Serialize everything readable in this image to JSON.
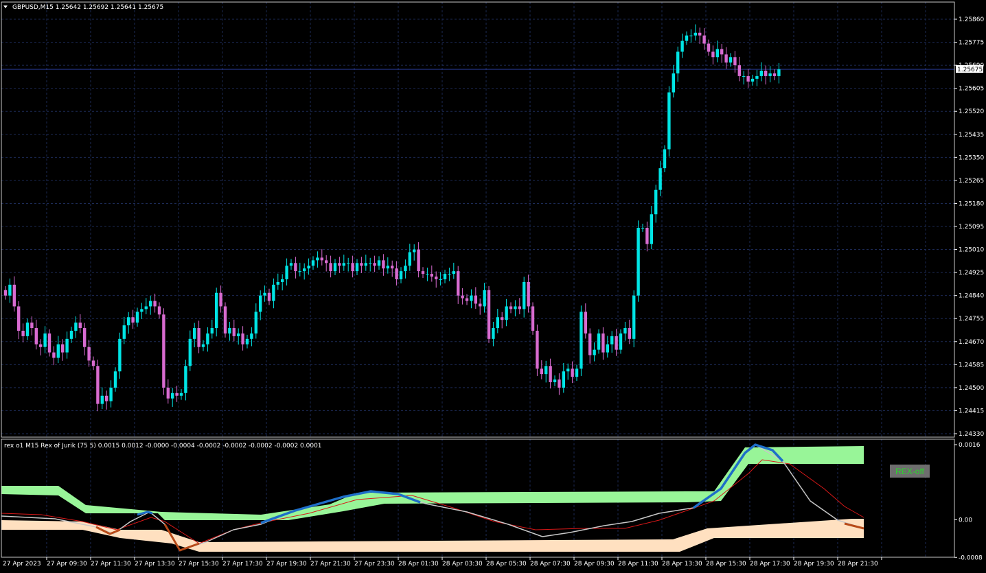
{
  "main": {
    "header_icon": "triangle-down-icon",
    "header": "GBPUSD,M15  1.25642 1.25692 1.25641 1.25675",
    "current_price": "1.25675",
    "price_axis": [
      "1.25860",
      "1.25775",
      "1.25690",
      "1.25605",
      "1.25520",
      "1.25435",
      "1.25350",
      "1.25265",
      "1.25180",
      "1.25095",
      "1.25010",
      "1.24925",
      "1.24840",
      "1.24755",
      "1.24670",
      "1.24585",
      "1.24500",
      "1.24415",
      "1.24330"
    ]
  },
  "indicator": {
    "header": "rex o1 M15 Rex of Jurik (75 5) 0.0015 0.0012 -0.0000 -0.0004 -0.0002 -0.0002 -0.0002 -0.0002 0.0001",
    "axis": [
      "0.0016",
      "0.00",
      "-0.0008"
    ],
    "button_label": "REX-off"
  },
  "time_axis": [
    "27 Apr 2023",
    "27 Apr 09:30",
    "27 Apr 11:30",
    "27 Apr 13:30",
    "27 Apr 15:30",
    "27 Apr 17:30",
    "27 Apr 19:30",
    "27 Apr 21:30",
    "27 Apr 23:30",
    "28 Apr 01:30",
    "28 Apr 03:30",
    "28 Apr 05:30",
    "28 Apr 07:30",
    "28 Apr 09:30",
    "28 Apr 11:30",
    "28 Apr 13:30",
    "28 Apr 15:30",
    "28 Apr 17:30",
    "28 Apr 19:30",
    "28 Apr 21:30"
  ],
  "colors": {
    "background": "#000000",
    "bull": "#00e5e5",
    "bear": "#d86bd0",
    "grid": "#1c2a55",
    "green_band": "#98f598",
    "peach_band": "#ffe0c0",
    "fast_line": "#c8c8c8",
    "slow_line": "#d81818",
    "highlight": "#1e6ec8",
    "highlight_down": "#b84a18"
  },
  "closes": [
    1.2484,
    1.2488,
    1.248,
    1.2471,
    1.2469,
    1.2474,
    1.2472,
    1.2466,
    1.2465,
    1.247,
    1.2463,
    1.2461,
    1.2466,
    1.2463,
    1.2468,
    1.2471,
    1.2474,
    1.2472,
    1.2465,
    1.246,
    1.2458,
    1.2444,
    1.2447,
    1.2445,
    1.245,
    1.2456,
    1.2468,
    1.2473,
    1.2476,
    1.2474,
    1.2478,
    1.2479,
    1.248,
    1.2482,
    1.248,
    1.2477,
    1.245,
    1.2446,
    1.2448,
    1.2447,
    1.2448,
    1.2458,
    1.2468,
    1.2472,
    1.2465,
    1.2466,
    1.247,
    1.2472,
    1.2485,
    1.248,
    1.247,
    1.2472,
    1.2469,
    1.247,
    1.2466,
    1.2468,
    1.247,
    1.2478,
    1.2484,
    1.2485,
    1.2482,
    1.2488,
    1.2489,
    1.249,
    1.2495,
    1.2496,
    1.2493,
    1.2493,
    1.2494,
    1.2495,
    1.2497,
    1.2498,
    1.2497,
    1.2496,
    1.2493,
    1.2496,
    1.2495,
    1.2496,
    1.2496,
    1.2493,
    1.2496,
    1.2495,
    1.2496,
    1.2496,
    1.2495,
    1.2497,
    1.2494,
    1.2495,
    1.2494,
    1.249,
    1.2493,
    1.2495,
    1.25,
    1.2501,
    1.2493,
    1.2492,
    1.2492,
    1.2491,
    1.249,
    1.249,
    1.2492,
    1.2492,
    1.2493,
    1.2484,
    1.2483,
    1.2482,
    1.2484,
    1.2481,
    1.248,
    1.2486,
    1.2468,
    1.2472,
    1.2476,
    1.2475,
    1.248,
    1.2479,
    1.248,
    1.2479,
    1.2489,
    1.248,
    1.2471,
    1.2457,
    1.2455,
    1.2458,
    1.2452,
    1.2453,
    1.245,
    1.2456,
    1.2457,
    1.2454,
    1.2457,
    1.2478,
    1.247,
    1.2462,
    1.2464,
    1.247,
    1.2463,
    1.2466,
    1.2469,
    1.2464,
    1.247,
    1.2472,
    1.2468,
    1.2484,
    1.2509,
    1.2509,
    1.2503,
    1.2514,
    1.2523,
    1.2531,
    1.2538,
    1.2559,
    1.2566,
    1.2574,
    1.2578,
    1.258,
    1.258,
    1.2581,
    1.258,
    1.2577,
    1.2574,
    1.2572,
    1.2575,
    1.2573,
    1.257,
    1.2572,
    1.2569,
    1.2565,
    1.2565,
    1.2563,
    1.2564,
    1.2565,
    1.2567,
    1.2565,
    1.2566,
    1.2565,
    1.25675
  ]
}
